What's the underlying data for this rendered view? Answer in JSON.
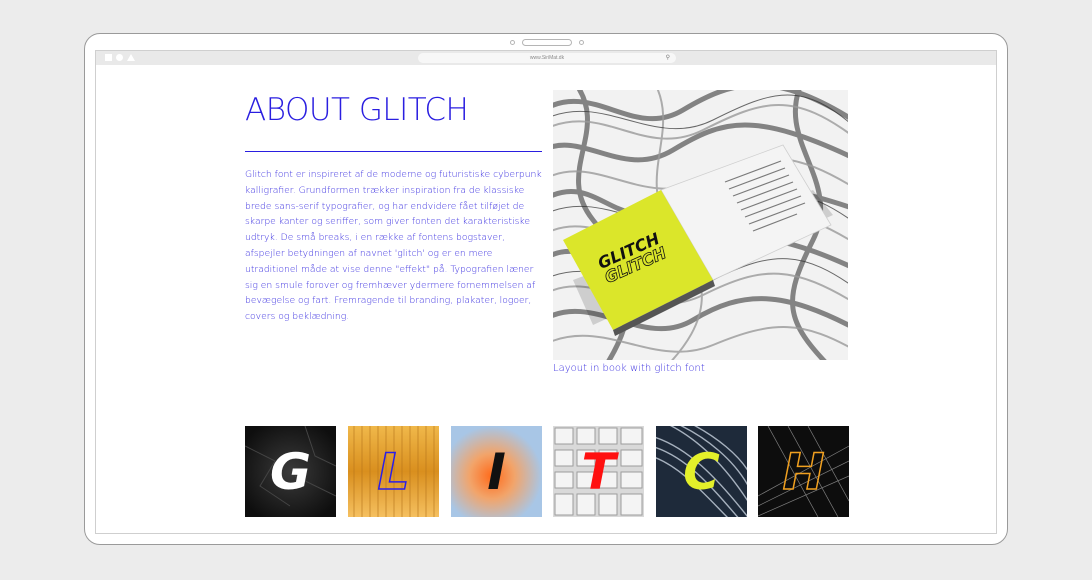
{
  "browser": {
    "url": "www.SiriMat.dk"
  },
  "about": {
    "title": "ABOUT GLITCH",
    "body": "Glitch font er inspireret af de moderne og futuristiske cyberpunk kalligrafier. Grundformen trækker inspiration fra de klassiske brede sans-serif typografier, og har endvidere fået tilføjet de skarpe kanter og seriffer, som giver fonten det karakteristiske udtryk. De små breaks, i en række af fontens bogstaver, afspejler betydningen af navnet 'glitch' og er en mere utraditionel måde at vise denne \"effekt\" på. Typografien læner sig en smule forover og fremhæver ydermere fornemmelsen af bevægelse og fart. Fremragende til branding, plakater, logoer, covers og beklædning."
  },
  "hero": {
    "book_word_1": "GLITCH",
    "book_word_2": "GLITCH",
    "caption": "Layout in book with glitch font"
  },
  "letters": [
    {
      "char": "G",
      "color": "#ffffff",
      "bg": "#1b1b1b"
    },
    {
      "char": "L",
      "color": "#2b1ee8",
      "bg": "#e0a33a"
    },
    {
      "char": "I",
      "color": "#111111",
      "bg": "#a9c8e8"
    },
    {
      "char": "T",
      "color": "#ff1010",
      "bg": "#d8d8d8"
    },
    {
      "char": "C",
      "color": "#e4f02a",
      "bg": "#1e2a3a"
    },
    {
      "char": "H",
      "color": "#f0a020",
      "bg": "#0d0d0d"
    }
  ],
  "colors": {
    "accent": "#2a1ee0",
    "book_cover": "#dbe62a"
  }
}
